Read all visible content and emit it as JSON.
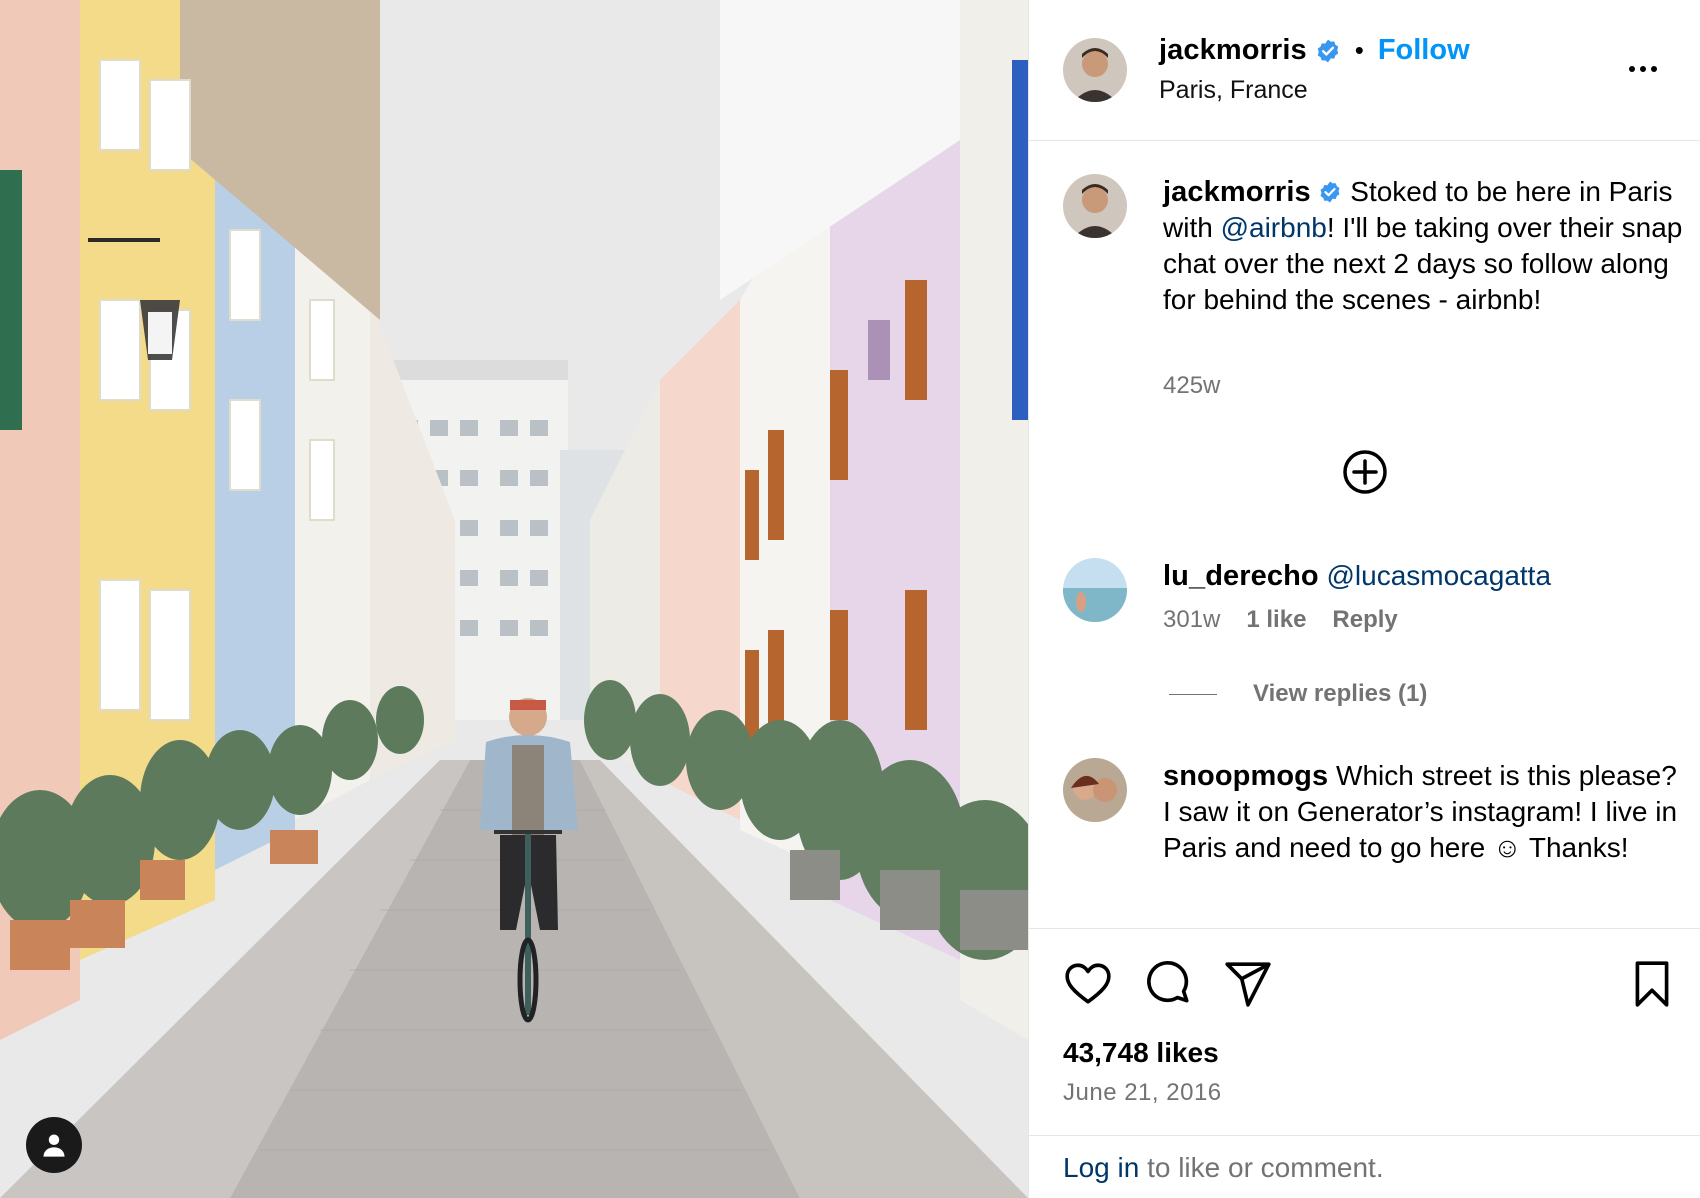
{
  "post": {
    "author": {
      "username": "jackmorris",
      "verified": true,
      "follow_label": "Follow",
      "location": "Paris, France"
    },
    "caption": {
      "username": "jackmorris",
      "text_before": "Stoked to be here in Paris with ",
      "mention": "@airbnb",
      "text_after": "! I'll be taking over their snap chat over the next 2 days so follow along for behind the scenes - airbnb!",
      "age": "425w"
    },
    "comments": [
      {
        "username": "lu_derecho",
        "mention": "@lucasmocagatta",
        "age": "301w",
        "likes": "1 like",
        "reply_label": "Reply",
        "view_replies": "View replies (1)"
      },
      {
        "username": "snoopmogs",
        "text": "Which street is this please? I saw it on Generator’s instagram! I live in Paris and need to go here ☺ Thanks!"
      }
    ],
    "likes": "43,748 likes",
    "date": "June 21, 2016",
    "login_link": "Log in",
    "login_rest": " to like or comment."
  },
  "icons": {
    "verified": "verified-badge-icon",
    "more": "more-options-icon",
    "add": "add-comment-circle-icon",
    "like": "heart-icon",
    "comment": "comment-bubble-icon",
    "share": "paper-plane-icon",
    "save": "bookmark-icon",
    "tag": "user-tag-icon"
  },
  "colors": {
    "link_blue": "#0095f6",
    "mention_blue": "#00376b",
    "verified_blue": "#3897f0",
    "secondary_text": "#737373"
  }
}
